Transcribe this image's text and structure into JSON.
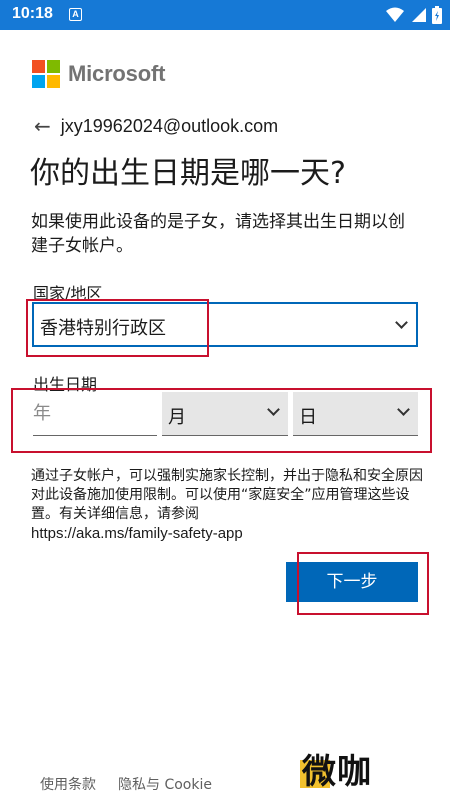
{
  "status_bar": {
    "time": "10:18",
    "notification_glyph": "A",
    "icons": [
      "wifi-icon",
      "signal-icon",
      "battery-icon"
    ],
    "color": "#1679d6"
  },
  "brand": {
    "name": "Microsoft",
    "logo_colors": [
      "#f25022",
      "#7fba00",
      "#00a4ef",
      "#ffb900"
    ]
  },
  "account": {
    "back_icon": "back-arrow-icon",
    "email": "jxy19962024@outlook.com"
  },
  "page": {
    "title": "你的出生日期是哪一天?",
    "description": "如果使用此设备的是子女，请选择其出生日期以创建子女帐户。"
  },
  "form": {
    "country_label": "国家/地区",
    "country_value": "香港特别行政区",
    "dob_label": "出生日期",
    "year_placeholder": "年",
    "month_value": "月",
    "day_value": "日"
  },
  "info": {
    "text": "通过子女帐户，可以强制实施家长控制，并出于隐私和安全原因对此设备施加使用限制。可以使用“家庭安全”应用管理这些设置。有关详细信息，请参阅",
    "url": "https://aka.ms/family-safety-app"
  },
  "actions": {
    "next_label": "下一步",
    "accent": "#0067b8"
  },
  "footer": {
    "terms": "使用条款",
    "privacy": "隐私与 Cookie"
  },
  "watermark": {
    "text": "微咖"
  },
  "highlight_color": "#c8102e"
}
